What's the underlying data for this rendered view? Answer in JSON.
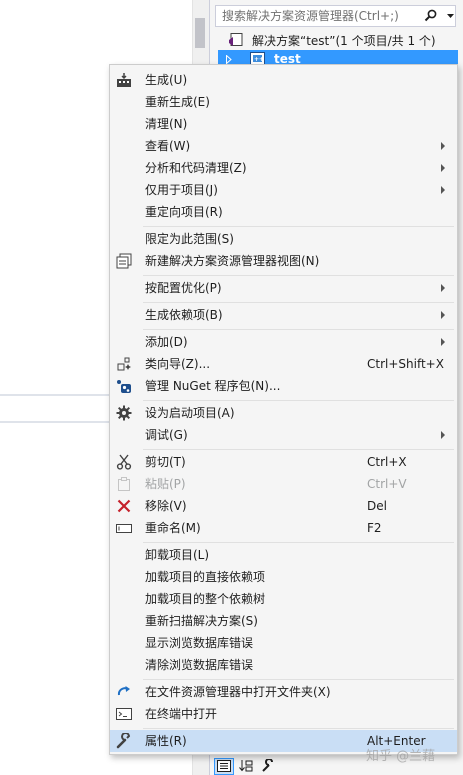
{
  "solution_explorer": {
    "search_placeholder": "搜索解决方案资源管理器(Ctrl+;)",
    "solution_label": "解决方案“test”(1 个项目/共 1 个)",
    "project_name": "test"
  },
  "menu": {
    "build": "生成(U)",
    "rebuild": "重新生成(E)",
    "clean": "清理(N)",
    "view": "查看(W)",
    "analyze": "分析和代码清理(Z)",
    "project_only": "仅用于项目(J)",
    "retarget": "重定向项目(R)",
    "scope_to_this": "限定为此范围(S)",
    "new_view": "新建解决方案资源管理器视图(N)",
    "config_optimize": "按配置优化(P)",
    "build_deps": "生成依赖项(B)",
    "add": "添加(D)",
    "class_wizard": "类向导(Z)...",
    "class_wizard_shortcut": "Ctrl+Shift+X",
    "nuget": "管理 NuGet 程序包(N)...",
    "set_startup": "设为启动项目(A)",
    "debug": "调试(G)",
    "cut": "剪切(T)",
    "cut_shortcut": "Ctrl+X",
    "paste": "粘贴(P)",
    "paste_shortcut": "Ctrl+V",
    "remove": "移除(V)",
    "remove_shortcut": "Del",
    "rename": "重命名(M)",
    "rename_shortcut": "F2",
    "unload": "卸载项目(L)",
    "load_direct_deps": "加载项目的直接依赖项",
    "load_dep_tree": "加载项目的整个依赖树",
    "rescan": "重新扫描解决方案(S)",
    "show_db_errors": "显示浏览数据库错误",
    "clear_db_errors": "清除浏览数据库错误",
    "open_in_explorer": "在文件资源管理器中打开文件夹(X)",
    "open_in_terminal": "在终端中打开",
    "properties": "属性(R)",
    "properties_shortcut": "Alt+Enter"
  },
  "watermark": "知乎 @兰藉"
}
